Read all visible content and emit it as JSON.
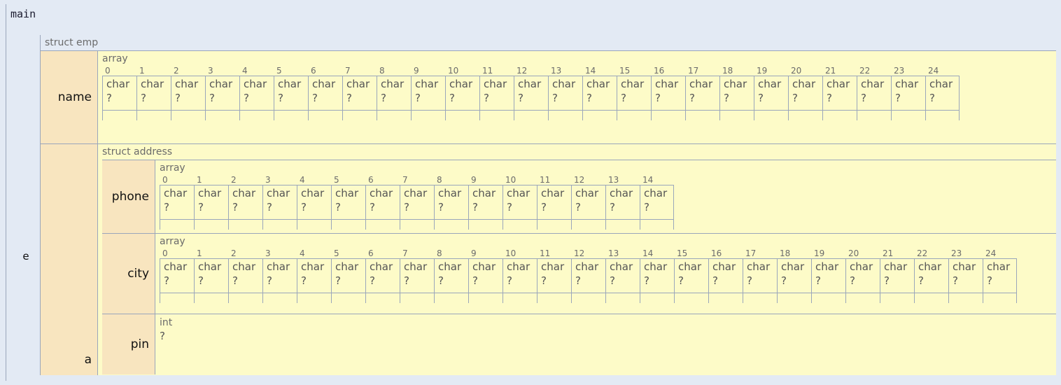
{
  "frame": {
    "name": "main"
  },
  "variable": {
    "label": "e",
    "type_title": "struct emp"
  },
  "members": [
    {
      "name": "name",
      "kind": "array",
      "element_type_title": "array",
      "cell_type": "char",
      "cell_value": "?",
      "indices": [
        0,
        1,
        2,
        3,
        4,
        5,
        6,
        7,
        8,
        9,
        10,
        11,
        12,
        13,
        14,
        15,
        16,
        17,
        18,
        19,
        20,
        21,
        22,
        23,
        24
      ],
      "length": 25
    },
    {
      "name": "a",
      "kind": "struct",
      "type_title": "struct address",
      "members": [
        {
          "name": "phone",
          "kind": "array",
          "element_type_title": "array",
          "cell_type": "char",
          "cell_value": "?",
          "indices": [
            0,
            1,
            2,
            3,
            4,
            5,
            6,
            7,
            8,
            9,
            10,
            11,
            12,
            13,
            14
          ],
          "length": 15
        },
        {
          "name": "city",
          "kind": "array",
          "element_type_title": "array",
          "cell_type": "char",
          "cell_value": "?",
          "indices": [
            0,
            1,
            2,
            3,
            4,
            5,
            6,
            7,
            8,
            9,
            10,
            11,
            12,
            13,
            14,
            15,
            16,
            17,
            18,
            19,
            20,
            21,
            22,
            23,
            24
          ],
          "length": 25
        },
        {
          "name": "pin",
          "kind": "scalar",
          "type_title": "int",
          "value": "?"
        }
      ]
    }
  ],
  "colors": {
    "background": "#e3eaf4",
    "struct_body": "#fdfbc8",
    "member_label": "#f8e5bf",
    "border": "#9aa6bb",
    "text_primary": "#111111",
    "text_secondary": "#6b6b6b",
    "text_value": "#555555"
  }
}
